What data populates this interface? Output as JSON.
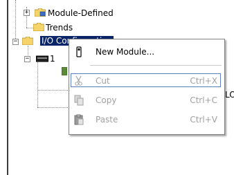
{
  "tree": {
    "items": [
      {
        "label": "Module-Defined",
        "expander": "+"
      },
      {
        "label": "Trends"
      },
      {
        "label": "I/O Configuration",
        "expander": "−"
      },
      {
        "label": "1",
        "expander": "−"
      }
    ]
  },
  "menu": {
    "items": [
      {
        "label": "New Module...",
        "shortcut": "",
        "enabled": true,
        "icon": "new-module-icon"
      },
      {
        "label": "Cut",
        "shortcut": "Ctrl+X",
        "enabled": false,
        "icon": "scissors-icon"
      },
      {
        "label": "Copy",
        "shortcut": "Ctrl+C",
        "enabled": false,
        "icon": "copy-icon"
      },
      {
        "label": "Paste",
        "shortcut": "Ctrl+V",
        "enabled": false,
        "icon": "paste-icon"
      }
    ]
  },
  "background": {
    "partial_label": "LOG"
  },
  "colors": {
    "selection": "#0a246a",
    "folder": "#f5d46b",
    "disabled_text": "#a0a0a0"
  }
}
